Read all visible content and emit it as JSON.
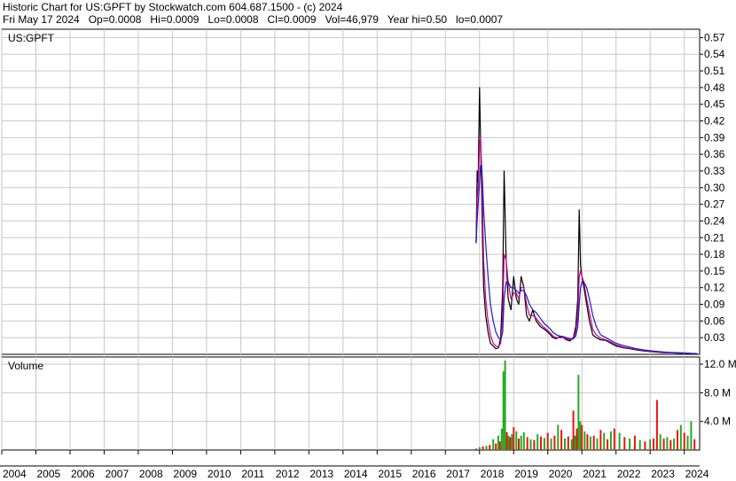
{
  "header": {
    "line1": "Historic Chart for US:GPFT by Stockwatch.com 604.687.1500 - (c) 2024",
    "line2": "Fri May 17 2024   Op=0.0008   Hi=0.0009   Lo=0.0008   Cl=0.0009   Vol=46,979   Year hi=0.50   lo=0.0007"
  },
  "colors": {
    "grid": "#c8c8c8",
    "price": "#000000",
    "ma_short": "#d0008a",
    "ma_long": "#1a1acc",
    "vol_up": "#22aa22",
    "vol_down": "#ee1111"
  },
  "chart_data": [
    {
      "type": "line",
      "symbol": "US:GPFT",
      "y_ticks": [
        "0.57",
        "0.54",
        "0.51",
        "0.48",
        "0.45",
        "0.42",
        "0.39",
        "0.36",
        "0.33",
        "0.30",
        "0.27",
        "0.24",
        "0.21",
        "0.18",
        "0.15",
        "0.12",
        "0.09",
        "0.06",
        "0.03"
      ],
      "ylim": [
        0,
        0.585
      ],
      "x_labels": [
        "2004",
        "2005",
        "2006",
        "2007",
        "2008",
        "2009",
        "2010",
        "2011",
        "2012",
        "2013",
        "2014",
        "2015",
        "2016",
        "2017",
        "2018",
        "2019",
        "2020",
        "2021",
        "2022",
        "2023",
        "2024"
      ],
      "x": [
        2017.9,
        2017.93,
        2017.96,
        2018.0,
        2018.03,
        2018.06,
        2018.09,
        2018.12,
        2018.18,
        2018.25,
        2018.32,
        2018.4,
        2018.48,
        2018.56,
        2018.62,
        2018.68,
        2018.72,
        2018.78,
        2018.84,
        2018.92,
        2019.0,
        2019.08,
        2019.15,
        2019.22,
        2019.3,
        2019.38,
        2019.46,
        2019.56,
        2019.66,
        2019.78,
        2019.9,
        2020.0,
        2020.08,
        2020.15,
        2020.25,
        2020.35,
        2020.45,
        2020.55,
        2020.65,
        2020.75,
        2020.82,
        2020.88,
        2020.92,
        2020.96,
        2021.0,
        2021.06,
        2021.14,
        2021.22,
        2021.32,
        2021.42,
        2021.55,
        2021.7,
        2021.85,
        2022.0,
        2022.2,
        2022.4,
        2022.6,
        2022.8,
        2023.0,
        2023.2,
        2023.4,
        2023.6,
        2023.8,
        2024.0,
        2024.2,
        2024.38
      ],
      "series": [
        {
          "name": "price",
          "values": [
            0.2,
            0.33,
            0.31,
            0.48,
            0.39,
            0.3,
            0.2,
            0.12,
            0.07,
            0.04,
            0.02,
            0.015,
            0.01,
            0.012,
            0.03,
            0.12,
            0.33,
            0.17,
            0.1,
            0.08,
            0.14,
            0.1,
            0.09,
            0.14,
            0.12,
            0.07,
            0.06,
            0.08,
            0.06,
            0.05,
            0.045,
            0.04,
            0.035,
            0.03,
            0.028,
            0.032,
            0.03,
            0.026,
            0.024,
            0.03,
            0.05,
            0.1,
            0.26,
            0.16,
            0.14,
            0.12,
            0.09,
            0.06,
            0.035,
            0.03,
            0.026,
            0.025,
            0.02,
            0.015,
            0.012,
            0.01,
            0.008,
            0.006,
            0.005,
            0.004,
            0.003,
            0.003,
            0.002,
            0.002,
            0.001,
            0.0009
          ]
        },
        {
          "name": "ma_short",
          "values": [
            0.2,
            0.28,
            0.3,
            0.38,
            0.39,
            0.34,
            0.26,
            0.17,
            0.1,
            0.06,
            0.035,
            0.02,
            0.015,
            0.014,
            0.02,
            0.07,
            0.18,
            0.17,
            0.13,
            0.1,
            0.11,
            0.11,
            0.1,
            0.12,
            0.12,
            0.09,
            0.07,
            0.07,
            0.065,
            0.055,
            0.048,
            0.043,
            0.038,
            0.033,
            0.03,
            0.03,
            0.03,
            0.028,
            0.026,
            0.028,
            0.04,
            0.07,
            0.14,
            0.15,
            0.14,
            0.13,
            0.1,
            0.075,
            0.045,
            0.035,
            0.029,
            0.026,
            0.022,
            0.017,
            0.013,
            0.011,
            0.009,
            0.007,
            0.0055,
            0.0045,
            0.0035,
            0.003,
            0.0025,
            0.002,
            0.0015,
            0.0011
          ]
        },
        {
          "name": "ma_long",
          "values": [
            0.2,
            0.24,
            0.27,
            0.31,
            0.34,
            0.34,
            0.31,
            0.26,
            0.2,
            0.14,
            0.09,
            0.06,
            0.04,
            0.03,
            0.025,
            0.04,
            0.1,
            0.13,
            0.13,
            0.12,
            0.12,
            0.115,
            0.11,
            0.115,
            0.115,
            0.105,
            0.09,
            0.08,
            0.075,
            0.065,
            0.055,
            0.05,
            0.045,
            0.04,
            0.035,
            0.033,
            0.032,
            0.03,
            0.028,
            0.028,
            0.033,
            0.05,
            0.09,
            0.12,
            0.13,
            0.13,
            0.12,
            0.1,
            0.07,
            0.05,
            0.035,
            0.03,
            0.025,
            0.02,
            0.016,
            0.013,
            0.01,
            0.008,
            0.0065,
            0.0052,
            0.0042,
            0.0035,
            0.003,
            0.0024,
            0.0018,
            0.0014
          ]
        }
      ]
    },
    {
      "type": "bar",
      "title": "Volume",
      "y_ticks": [
        "12.0 M",
        "8.0 M",
        "4.0 M"
      ],
      "ylim": [
        0,
        13.0
      ],
      "unit": "M",
      "x": [
        2017.9,
        2018.0,
        2018.1,
        2018.2,
        2018.3,
        2018.4,
        2018.48,
        2018.55,
        2018.6,
        2018.65,
        2018.7,
        2018.75,
        2018.8,
        2018.85,
        2018.9,
        2018.95,
        2019.0,
        2019.08,
        2019.15,
        2019.22,
        2019.3,
        2019.4,
        2019.5,
        2019.6,
        2019.7,
        2019.8,
        2019.9,
        2020.0,
        2020.1,
        2020.2,
        2020.3,
        2020.4,
        2020.5,
        2020.6,
        2020.7,
        2020.75,
        2020.8,
        2020.85,
        2020.9,
        2020.95,
        2021.0,
        2021.08,
        2021.16,
        2021.25,
        2021.35,
        2021.45,
        2021.55,
        2021.65,
        2021.75,
        2021.85,
        2021.95,
        2022.1,
        2022.25,
        2022.4,
        2022.55,
        2022.7,
        2022.85,
        2023.0,
        2023.1,
        2023.2,
        2023.3,
        2023.4,
        2023.5,
        2023.6,
        2023.7,
        2023.8,
        2023.9,
        2024.0,
        2024.1,
        2024.2,
        2024.3
      ],
      "values": [
        0.2,
        0.4,
        0.5,
        0.6,
        0.7,
        1.5,
        0.9,
        2.0,
        1.2,
        3.0,
        11.0,
        12.5,
        2.5,
        2.0,
        1.8,
        2.2,
        3.2,
        2.6,
        1.6,
        2.0,
        2.5,
        1.8,
        1.5,
        1.4,
        2.2,
        1.9,
        1.7,
        2.4,
        1.6,
        2.0,
        3.5,
        2.8,
        1.6,
        1.9,
        1.5,
        5.5,
        2.0,
        3.0,
        10.5,
        4.0,
        3.5,
        2.6,
        2.2,
        1.9,
        2.0,
        1.6,
        2.8,
        2.4,
        1.5,
        2.6,
        3.0,
        2.4,
        1.8,
        1.6,
        2.0,
        1.4,
        1.2,
        1.5,
        1.6,
        7.0,
        2.2,
        1.6,
        1.8,
        1.4,
        1.6,
        2.8,
        3.5,
        2.4,
        2.0,
        4.0,
        1.5
      ],
      "up": [
        false,
        true,
        false,
        true,
        false,
        true,
        false,
        true,
        false,
        true,
        true,
        true,
        false,
        true,
        false,
        true,
        false,
        true,
        false,
        true,
        true,
        false,
        true,
        false,
        true,
        false,
        true,
        false,
        true,
        false,
        true,
        false,
        true,
        false,
        true,
        false,
        true,
        false,
        true,
        true,
        false,
        true,
        false,
        true,
        false,
        true,
        false,
        true,
        false,
        true,
        false,
        true,
        false,
        true,
        false,
        true,
        false,
        true,
        false,
        false,
        true,
        false,
        true,
        false,
        true,
        false,
        true,
        false,
        true,
        true,
        false
      ]
    }
  ]
}
